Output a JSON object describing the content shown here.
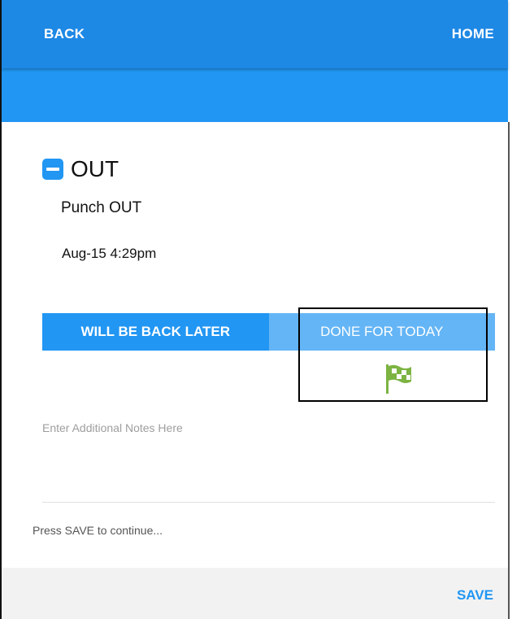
{
  "header": {
    "back_label": "BACK",
    "home_label": "HOME"
  },
  "status": {
    "icon": "minus-square-icon",
    "title": "OUT",
    "punch_label": "Punch OUT",
    "timestamp": "Aug-15 4:29pm"
  },
  "options": {
    "later_label": "WILL BE BACK LATER",
    "done_label": "DONE FOR TODAY",
    "done_icon": "checkered-flag-icon"
  },
  "notes": {
    "placeholder": "Enter Additional Notes Here",
    "value": ""
  },
  "hint": "Press SAVE to continue...",
  "footer": {
    "save_label": "SAVE"
  },
  "colors": {
    "primary": "#2196f3",
    "selected_option": "#64b5f6",
    "flag": "#7cb342"
  }
}
